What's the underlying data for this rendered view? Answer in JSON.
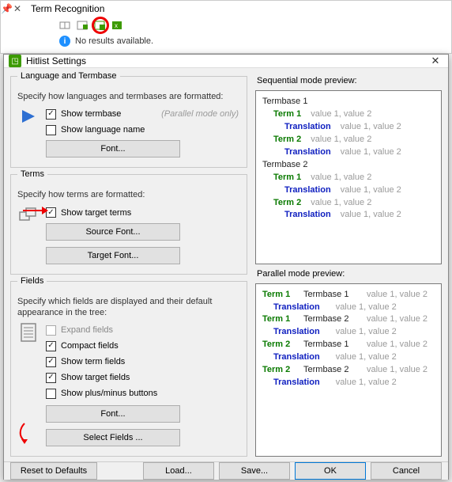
{
  "bg": {
    "panel_title": "Term Recognition",
    "status": "No results available."
  },
  "dialog": {
    "title": "Hitlist Settings"
  },
  "lang_group": {
    "title": "Language and Termbase",
    "desc": "Specify how languages and termbases are formatted:",
    "show_termbase": "Show termbase",
    "show_lang": "Show language name",
    "note": "(Parallel mode only)",
    "font_btn": "Font..."
  },
  "terms_group": {
    "title": "Terms",
    "desc": "Specify how terms are formatted:",
    "show_target": "Show target terms",
    "source_font": "Source Font...",
    "target_font": "Target Font..."
  },
  "fields_group": {
    "title": "Fields",
    "desc": "Specify which fields are displayed and their default appearance in the tree:",
    "expand": "Expand fields",
    "compact": "Compact fields",
    "show_term_fields": "Show term fields",
    "show_target_fields": "Show target fields",
    "show_plusminus": "Show plus/minus buttons",
    "font_btn": "Font...",
    "select_fields": "Select Fields ..."
  },
  "preview_seq": {
    "label": "Sequential mode preview:",
    "termbase1": "Termbase 1",
    "termbase2": "Termbase 2",
    "term1": "Term 1",
    "term2": "Term 2",
    "translation": "Translation",
    "values": "value 1, value 2"
  },
  "preview_par": {
    "label": "Parallel mode preview:",
    "term1": "Term 1",
    "term2": "Term 2",
    "termbase1": "Termbase 1",
    "termbase2": "Termbase 2",
    "translation": "Translation",
    "values": "value 1, value 2"
  },
  "footer": {
    "reset": "Reset to Defaults",
    "load": "Load...",
    "save": "Save...",
    "ok": "OK",
    "cancel": "Cancel"
  }
}
